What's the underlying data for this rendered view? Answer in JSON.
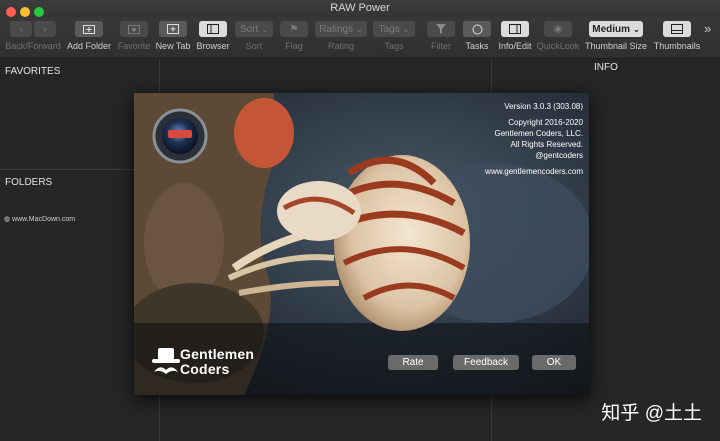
{
  "window": {
    "title": "RAW Power"
  },
  "toolbar": {
    "back_forward_label": "Back/Forward",
    "add_folder_label": "Add Folder",
    "favorite_label": "Favorite",
    "new_tab_label": "New Tab",
    "browser_label": "Browser",
    "sort_button": "Sort",
    "sort_label": "Sort",
    "flag_label": "Flag",
    "ratings_button": "Ratings",
    "rating_label": "Rating",
    "tags_button": "Tags",
    "tags_label": "Tags",
    "filter_label": "Filter",
    "tasks_label": "Tasks",
    "info_edit_label": "Info/Edit",
    "quicklook_label": "QuickLook",
    "thumbnail_size_value": "Medium",
    "thumbnail_size_label": "Thumbnail Size",
    "thumbnails_label": "Thumbnails",
    "overflow": "»"
  },
  "sidebar": {
    "favorites_title": "FAVORITES",
    "folders_title": "FOLDERS",
    "macdown_text": "www.MacDown.com"
  },
  "info_panel": {
    "title": "INFO"
  },
  "about": {
    "version": "Version 3.0.3 (303.08)",
    "copyright": "Copyright 2016-2020",
    "company": "Gentlemen Coders, LLC.",
    "rights": "All Rights Reserved.",
    "handle": "@gentcoders",
    "website": "www.gentlemencoders.com",
    "logo_line1": "Gentlemen",
    "logo_line2": "Coders",
    "rate_button": "Rate",
    "feedback_button": "Feedback",
    "ok_button": "OK"
  },
  "watermark": "知乎 @土土",
  "colors": {
    "close": "#fd5f57",
    "minimize": "#febc2e",
    "zoom": "#29c840",
    "window_bg": "#262626",
    "toolbar_bg": "#353535"
  }
}
